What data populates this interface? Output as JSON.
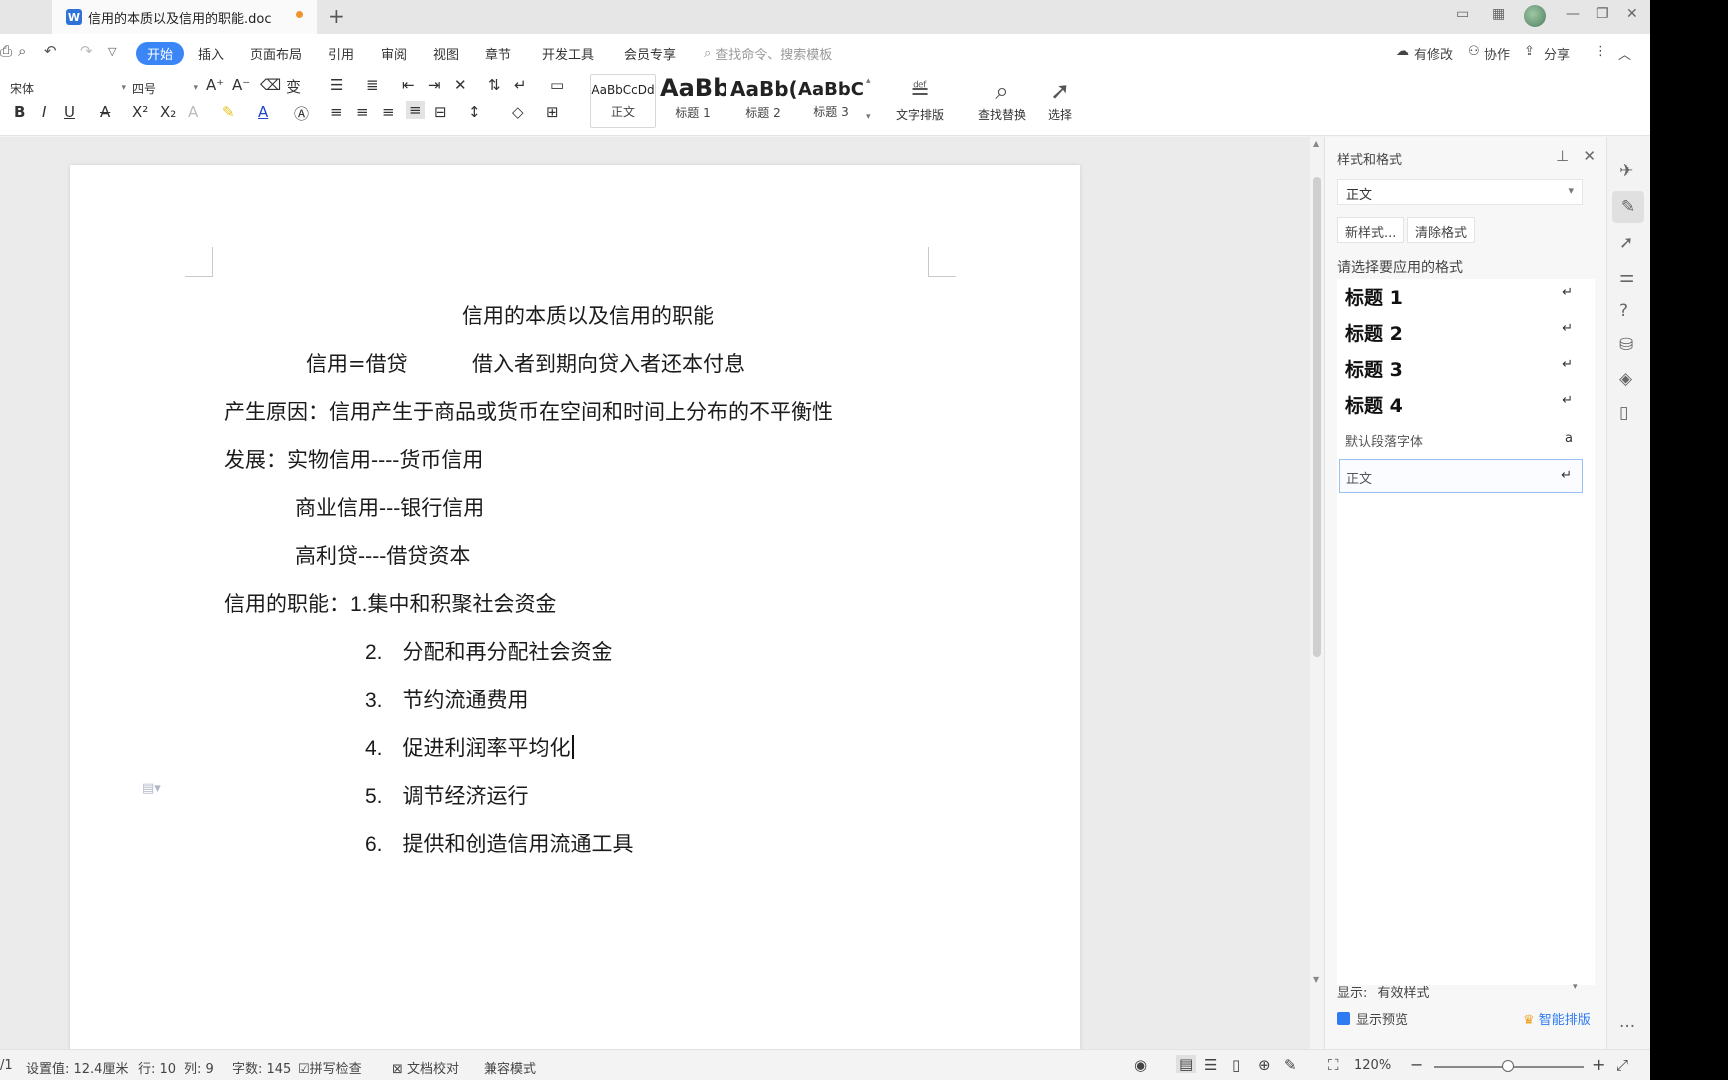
{
  "window": {
    "doc_tab_title": "信用的本质以及信用的职能.doc",
    "new_tab": "+"
  },
  "menu": {
    "items": [
      "开始",
      "插入",
      "页面布局",
      "引用",
      "审阅",
      "视图",
      "章节",
      "开发工具",
      "会员专享"
    ],
    "search_placeholder": "查找命令、搜索模板",
    "right": [
      "有修改",
      "协作",
      "分享"
    ]
  },
  "ribbon": {
    "font_name": "宋体",
    "font_size": "四号",
    "styles": [
      {
        "sample": "AaBbCcDd",
        "caption": "正文"
      },
      {
        "sample": "AaBb",
        "caption": "标题 1"
      },
      {
        "sample": "AaBb(",
        "caption": "标题 2"
      },
      {
        "sample": "AaBbC",
        "caption": "标题 3"
      }
    ],
    "tools": [
      "文字排版",
      "查找替换",
      "选择"
    ]
  },
  "document": {
    "title": "信用的本质以及信用的职能",
    "line1a": "信用=借贷",
    "line1b": "借入者到期向贷入者还本付息",
    "line2": "产生原因：信用产生于商品或货币在空间和时间上分布的不平衡性",
    "line3": "发展：实物信用----货币信用",
    "line4": "商业信用---银行信用",
    "line5": "高利贷----借贷资本",
    "func_label": "信用的职能：",
    "functions": [
      {
        "n": "1.",
        "text": "集中和积聚社会资金"
      },
      {
        "n": "2.",
        "text": "分配和再分配社会资金"
      },
      {
        "n": "3.",
        "text": "节约流通费用"
      },
      {
        "n": "4.",
        "text": "促进利润率平均化"
      },
      {
        "n": "5.",
        "text": "调节经济运行"
      },
      {
        "n": "6.",
        "text": "提供和创造信用流通工具"
      }
    ]
  },
  "panel": {
    "title": "样式和格式",
    "current_style": "正文",
    "new_style_btn": "新样式...",
    "clear_btn": "清除格式",
    "apply_label": "请选择要应用的格式",
    "styles": [
      "标题  1",
      "标题  2",
      "标题  3",
      "标题  4"
    ],
    "default_font": "默认段落字体",
    "default_font_mark": "a",
    "normal": "正文",
    "show_label": "显示:",
    "show_value": "有效样式",
    "preview_label": "显示预览",
    "smart_layout": "智能排版"
  },
  "status": {
    "page": "/1",
    "setting": "设置值: 12.4厘米",
    "row": "行: 10",
    "col": "列: 9",
    "words": "字数: 145",
    "spell": "拼写检查",
    "proof": "文档校对",
    "compat": "兼容模式",
    "zoom": "120%"
  }
}
